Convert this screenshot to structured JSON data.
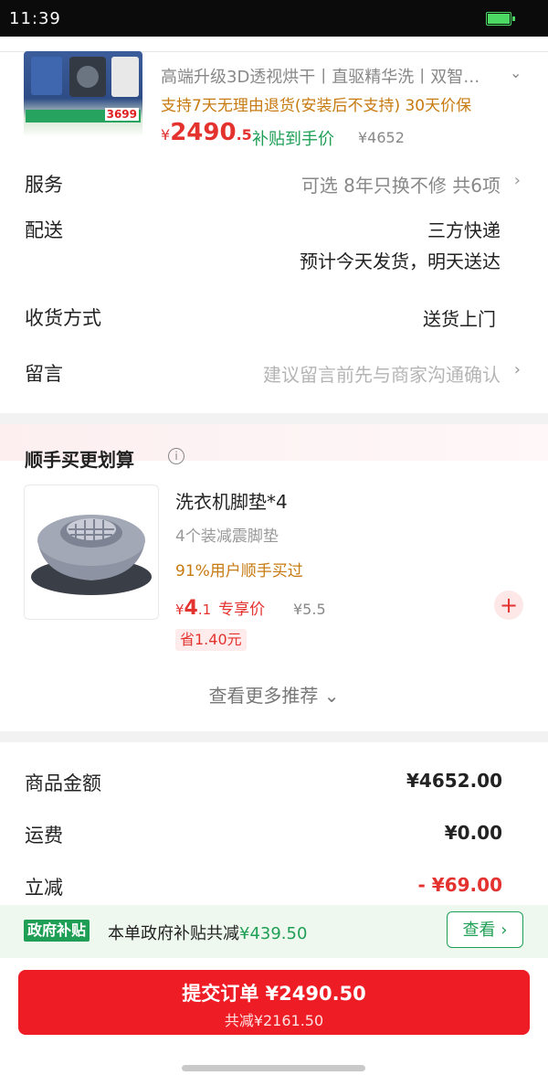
{
  "status_bar": {
    "time": "11:39"
  },
  "product": {
    "thumb_price": "3699",
    "title": "高端升级3D透视烘干丨直驱精华洗丨双智…",
    "policy": "支持7天无理由退货(安装后不支持) 30天价保",
    "price_symbol": "¥",
    "price_int": "2490",
    "price_dec": ".5",
    "subsidy_label": "补贴到手价",
    "original_price": "¥4652"
  },
  "rows": {
    "service": {
      "label": "服务",
      "value": "可选 8年只换不修 共6项"
    },
    "delivery": {
      "label": "配送",
      "value_line1": "三方快递",
      "value_line2": "预计今天发货，明天送达"
    },
    "receive": {
      "label": "收货方式",
      "value": "送货上门"
    },
    "message": {
      "label": "留言",
      "placeholder": "建议留言前先与商家沟通确认"
    }
  },
  "recommend": {
    "title": "顺手买更划算",
    "item": {
      "name": "洗衣机脚垫*4",
      "desc": "4个装减震脚垫",
      "social": "91%用户顺手买过",
      "price_symbol": "¥",
      "price_int": "4",
      "price_dec": ".1",
      "price_label": "专享价",
      "original": "¥5.5",
      "save": "省1.40元"
    },
    "more": "查看更多推荐"
  },
  "totals": {
    "goods": {
      "label": "商品金额",
      "value": "¥4652.00"
    },
    "shipping": {
      "label": "运费",
      "value": "¥0.00"
    },
    "discount": {
      "label": "立减",
      "value": "- ¥69.00"
    }
  },
  "gov": {
    "badge": "政府补贴",
    "text": "本单政府补贴共减",
    "amount": "¥439.50",
    "view_label": "查看"
  },
  "submit": {
    "label": "提交订单 ¥2490.50",
    "saving": "共减¥2161.50"
  },
  "colors": {
    "accent_red": "#ee1c24",
    "price_red": "#e4322f",
    "green": "#1f9f55",
    "orange": "#c77a10"
  }
}
